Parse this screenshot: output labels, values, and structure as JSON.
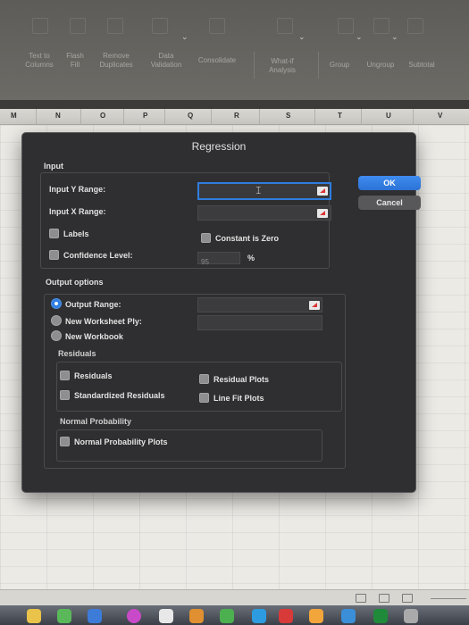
{
  "ribbon": {
    "items": [
      {
        "label": "Text to\nColumns"
      },
      {
        "label": "Flash\nFill"
      },
      {
        "label": "Remove\nDuplicates"
      },
      {
        "label": "Data\nValidation"
      },
      {
        "label": "Consolidate"
      },
      {
        "label": "What-if\nAnalysis"
      },
      {
        "label": "Group"
      },
      {
        "label": "Ungroup"
      },
      {
        "label": "Subtotal"
      }
    ]
  },
  "columns": [
    "M",
    "N",
    "O",
    "P",
    "Q",
    "R",
    "S",
    "T",
    "U",
    "V"
  ],
  "dialog": {
    "title": "Regression",
    "ok_label": "OK",
    "cancel_label": "Cancel",
    "input": {
      "heading": "Input",
      "y_range_label": "Input Y Range:",
      "y_range_value": "",
      "x_range_label": "Input X Range:",
      "x_range_value": "",
      "labels_label": "Labels",
      "labels_checked": false,
      "constant_zero_label": "Constant is Zero",
      "constant_zero_checked": false,
      "confidence_label": "Confidence Level:",
      "confidence_checked": false,
      "confidence_value": "95",
      "percent_sign": "%"
    },
    "output": {
      "heading": "Output options",
      "output_range_label": "Output Range:",
      "output_range_value": "",
      "new_ply_label": "New Worksheet Ply:",
      "new_ply_value": "",
      "new_workbook_label": "New Workbook",
      "selected": "output_range"
    },
    "residuals": {
      "heading": "Residuals",
      "residuals_label": "Residuals",
      "standardized_label": "Standardized Residuals",
      "residual_plots_label": "Residual Plots",
      "line_fit_label": "Line Fit Plots"
    },
    "normal": {
      "heading": "Normal Probability",
      "plots_label": "Normal Probability Plots"
    }
  },
  "colors": {
    "dialog_bg": "#2f2f31",
    "accent": "#2f7de0",
    "ribbon_bg": "#5d5c58",
    "sheet_bg": "#eceae5"
  }
}
